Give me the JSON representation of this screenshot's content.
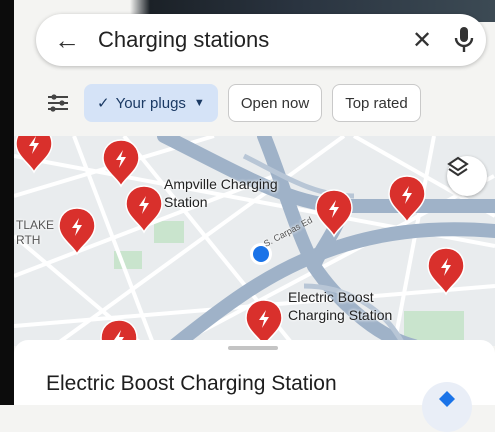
{
  "search": {
    "query": "Charging stations",
    "back_icon": "arrow-left-icon",
    "clear_icon": "close-icon",
    "mic_icon": "microphone-icon"
  },
  "filters": {
    "icon": "filter-sliders-icon",
    "chips": [
      {
        "label": "Your plugs",
        "selected": true,
        "check_icon": "check-icon",
        "dropdown_icon": "caret-down-icon"
      },
      {
        "label": "Open now",
        "selected": false
      },
      {
        "label": "Top rated",
        "selected": false
      }
    ]
  },
  "map": {
    "labels": {
      "ampville": "Ampville Charging\nStation",
      "electric_boost": "Electric Boost\nCharging Station",
      "area": "TLAKE\nRTH",
      "street": "S. Carpas Ed"
    },
    "layers_icon": "layers-icon",
    "pin_icon": "ev-charging-pin-icon",
    "location_icon": "current-location-dot",
    "colors": {
      "pin": "#d9302c",
      "road": "#9fb2c8",
      "park": "#c9e4cd",
      "location": "#1a73e8"
    }
  },
  "sheet": {
    "title": "Electric Boost Charging Station",
    "directions_icon": "directions-icon"
  }
}
